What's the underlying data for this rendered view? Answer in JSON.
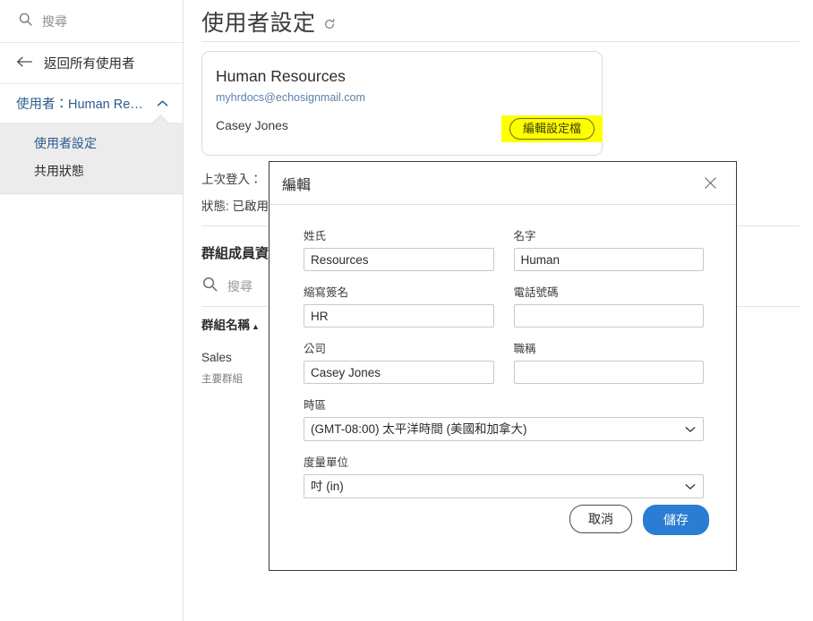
{
  "sidebar": {
    "search": {
      "placeholder": "搜尋",
      "icon": "search-icon"
    },
    "back": {
      "label": "返回所有使用者",
      "icon": "arrow-left-icon"
    },
    "group": {
      "label": "使用者：Human Re…",
      "chevron": "chevron-up-icon",
      "items": [
        {
          "label": "使用者設定",
          "active": true
        },
        {
          "label": "共用狀態",
          "active": false
        }
      ]
    }
  },
  "main": {
    "page_title": "使用者設定",
    "refresh_icon": "refresh-icon",
    "user_card": {
      "name": "Human Resources",
      "email": "myhrdocs@echosignmail.com",
      "company": "Casey Jones",
      "edit_button": "編輯設定檔",
      "highlight_color": "#ffff00"
    },
    "background": {
      "last_login_label": "上次登入：",
      "status_label": "狀態:",
      "status_value": " 已啟用",
      "group_membership_title": "群組成員資",
      "group_search_placeholder": "搜尋",
      "group_search_icon": "search-icon",
      "column_header": "群組名稱",
      "column_sort_caret": "▲",
      "row_name": "Sales",
      "row_sub": "主要群組"
    }
  },
  "modal": {
    "title": "編輯",
    "close_icon": "close-icon",
    "fields": {
      "last_name": {
        "label": "姓氏",
        "value": "Resources",
        "placeholder": ""
      },
      "first_name": {
        "label": "名字",
        "value": "Human",
        "placeholder": ""
      },
      "initials": {
        "label": "縮寫簽名",
        "value": "HR",
        "placeholder": ""
      },
      "phone": {
        "label": "電話號碼",
        "value": "",
        "placeholder": ""
      },
      "company": {
        "label": "公司",
        "value": "Casey Jones",
        "placeholder": ""
      },
      "job_title": {
        "label": "職稱",
        "value": "",
        "placeholder": ""
      },
      "timezone": {
        "label": "時區",
        "value": "(GMT-08:00) 太平洋時間 (美國和加拿大)",
        "chevron": "chevron-down-icon"
      },
      "units": {
        "label": "度量單位",
        "value": "吋 (in)",
        "chevron": "chevron-down-icon"
      }
    },
    "buttons": {
      "cancel": "取消",
      "save": "儲存",
      "save_color": "#2b7cd3"
    }
  }
}
